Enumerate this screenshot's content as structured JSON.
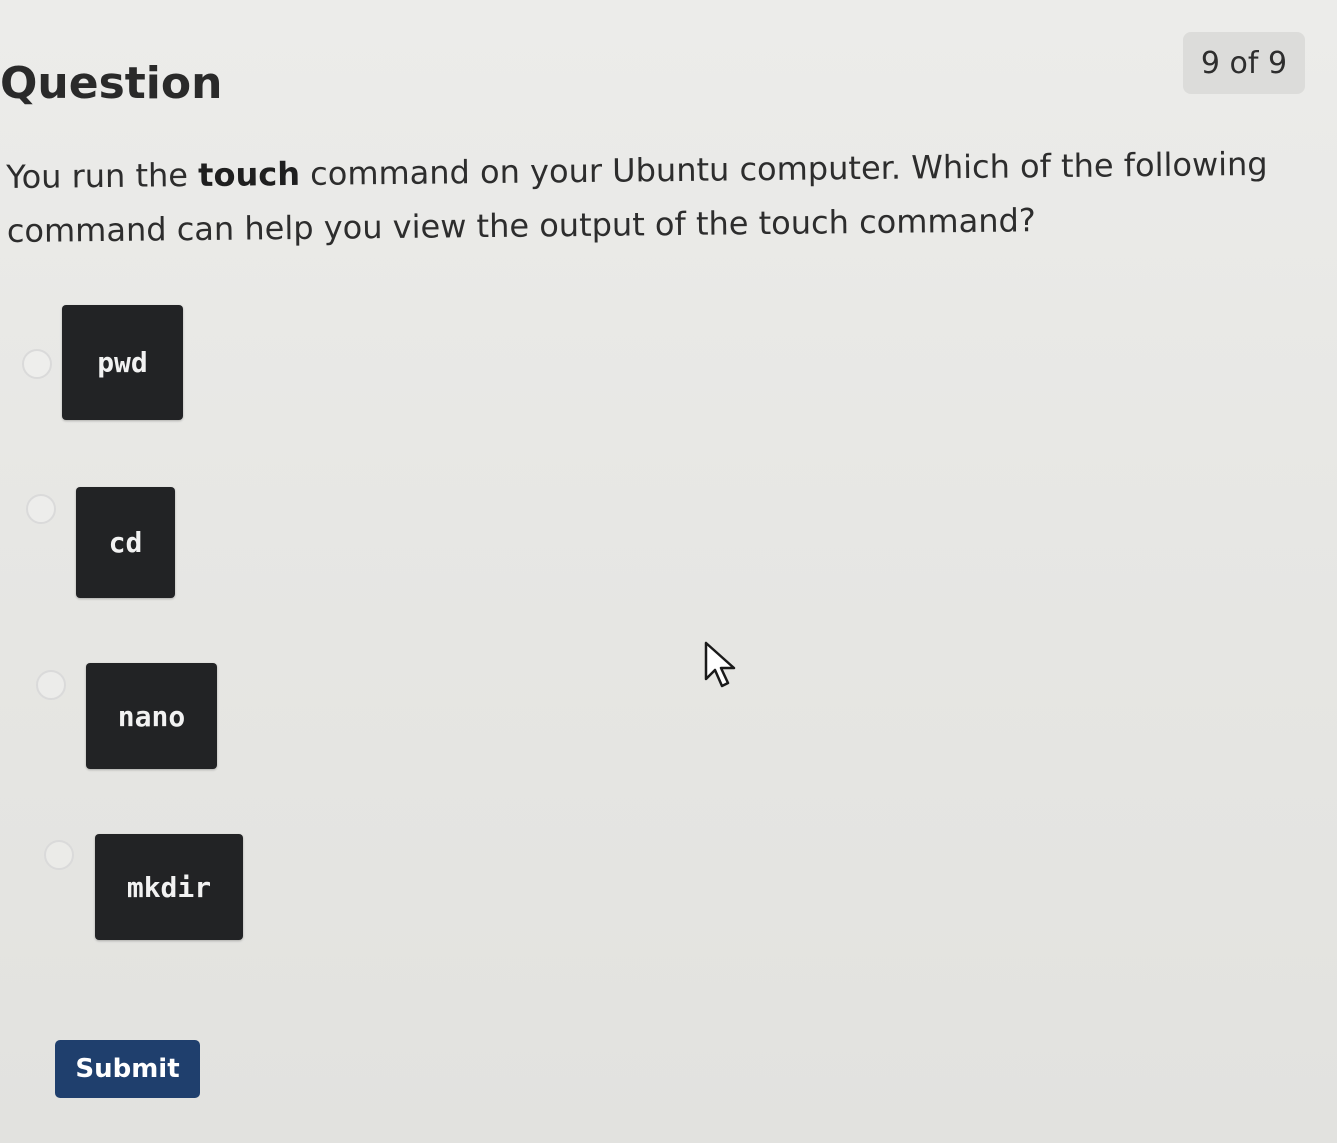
{
  "header": {
    "title": "Question",
    "counter": "9 of 9"
  },
  "question": {
    "prefix": "You run the ",
    "bold_word": "touch",
    "suffix": " command on your Ubuntu computer. Which of the following command can help you view the output of the touch command?"
  },
  "options": [
    {
      "label": "pwd",
      "selected": false
    },
    {
      "label": "cd",
      "selected": false
    },
    {
      "label": "nano",
      "selected": false
    },
    {
      "label": "mkdir",
      "selected": false
    }
  ],
  "actions": {
    "submit_label": "Submit"
  },
  "colors": {
    "chip_background": "#222325",
    "submit_background": "#1f3f6d",
    "page_background": "#e8e8e6"
  },
  "icons": {
    "cursor": "mouse-pointer-icon",
    "radio": "radio-circle-icon"
  }
}
